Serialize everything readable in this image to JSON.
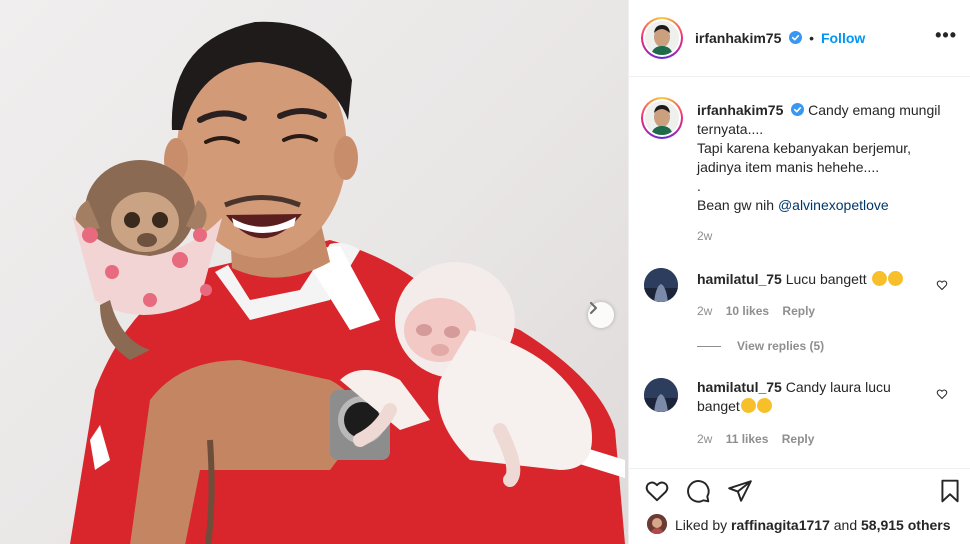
{
  "post": {
    "author": "irfanhakim75",
    "follow_label": "Follow",
    "more_label": "•••"
  },
  "caption": {
    "username": "irfanhakim75",
    "line1": "Candy emang mungil",
    "line2": "ternyata....",
    "line3": "Tapi karena kebanyakan berjemur,",
    "line4": "jadinya item manis hehehe....",
    "line5": ".",
    "line6_prefix": "Bean gw nih ",
    "mention": "@alvinexopetlove",
    "time": "2w"
  },
  "comments": [
    {
      "username": "hamilatul_75",
      "text": "Lucu bangett",
      "time": "2w",
      "likes": "10 likes",
      "reply": "Reply",
      "view_replies": "View replies (5)"
    },
    {
      "username": "hamilatul_75",
      "text_line1": "Candy laura lucu",
      "text_line2": "banget",
      "time": "2w",
      "likes": "11 likes",
      "reply": "Reply"
    }
  ],
  "likes": {
    "prefix": "Liked by ",
    "user": "raffinagita1717",
    "middle": " and ",
    "count": "58,915 others"
  },
  "icons": {
    "verified": "verified-badge-icon",
    "like": "heart-icon",
    "comment": "comment-icon",
    "share": "paper-plane-icon",
    "save": "bookmark-icon",
    "next": "chevron-right-icon"
  },
  "colors": {
    "link": "#0095f6",
    "mention": "#00376b",
    "muted": "#8e8e8e",
    "border": "#efefef"
  }
}
